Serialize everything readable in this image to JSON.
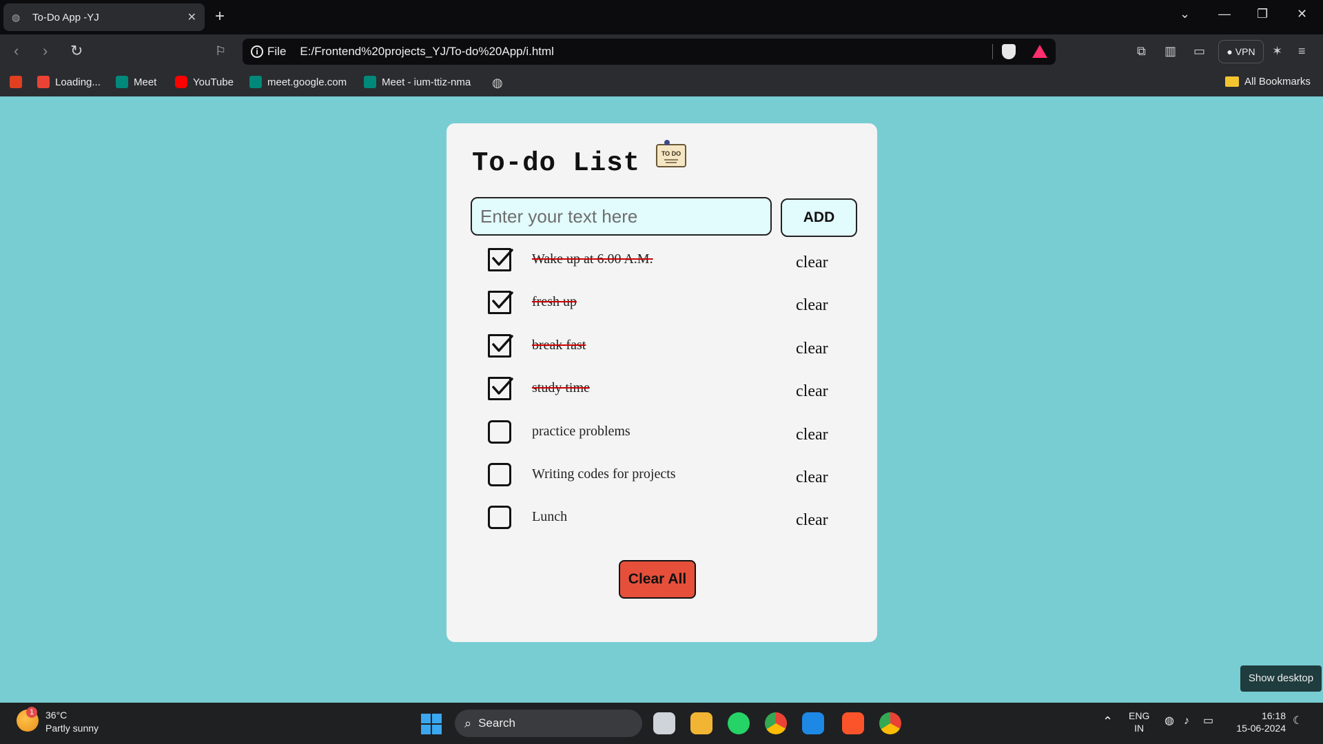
{
  "browser": {
    "tab_title": "To-Do App -YJ",
    "url_scheme": "File",
    "url": "E:/Frontend%20projects_YJ/To-do%20App/i.html",
    "vpn_label": "VPN",
    "bookmarks": [
      "Loading...",
      "Meet",
      "YouTube",
      "meet.google.com",
      "Meet - ium-ttiz-nma"
    ],
    "all_bookmarks": "All Bookmarks"
  },
  "app": {
    "title": "To-do List",
    "todo_badge": "TO DO",
    "input_placeholder": "Enter your text here",
    "add_label": "ADD",
    "clear_label": "clear",
    "clear_all_label": "Clear All",
    "items": [
      {
        "text": "Wake up at 6.00 A.M.",
        "done": true
      },
      {
        "text": "fresh up",
        "done": true
      },
      {
        "text": "break fast",
        "done": true
      },
      {
        "text": "study time",
        "done": true
      },
      {
        "text": "practice problems",
        "done": false
      },
      {
        "text": "Writing codes for projects",
        "done": false
      },
      {
        "text": "Lunch",
        "done": false
      }
    ]
  },
  "desktop": {
    "show_desktop": "Show desktop"
  },
  "taskbar": {
    "weather_temp": "36°C",
    "weather_desc": "Partly sunny",
    "weather_badge": "1",
    "search_label": "Search",
    "lang_top": "ENG",
    "lang_bottom": "IN",
    "time": "16:18",
    "date": "15-06-2024"
  },
  "colors": {
    "page_bg": "#78cdd3",
    "input_bg": "#e2fbfc",
    "clear_all_bg": "#e6503b",
    "strike": "#cc0000"
  }
}
